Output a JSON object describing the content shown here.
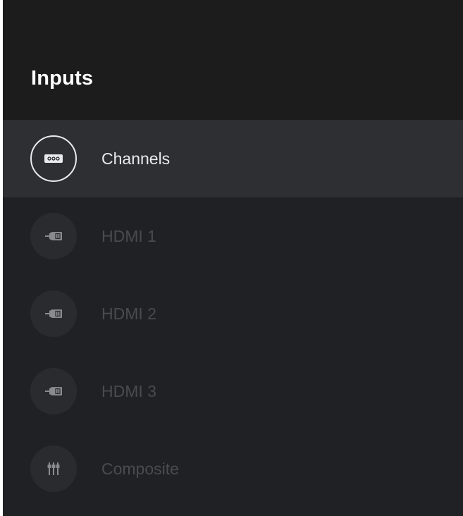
{
  "header": {
    "title": "Inputs"
  },
  "inputs": [
    {
      "label": "Channels",
      "icon": "tuner-icon",
      "selected": true
    },
    {
      "label": "HDMI 1",
      "icon": "hdmi-icon",
      "selected": false
    },
    {
      "label": "HDMI 2",
      "icon": "hdmi-icon",
      "selected": false
    },
    {
      "label": "HDMI 3",
      "icon": "hdmi-icon",
      "selected": false
    },
    {
      "label": "Composite",
      "icon": "composite-icon",
      "selected": false
    }
  ],
  "colors": {
    "panel_bg": "#202124",
    "header_bg": "#1c1c1d",
    "selected_bg": "#2e2f32",
    "selected_text": "#e8eaed",
    "dim_text": "#4a4b4e"
  }
}
